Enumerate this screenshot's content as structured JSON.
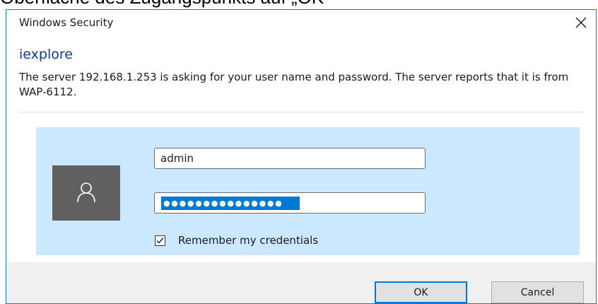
{
  "background_caption": "Oberfläche des Zugangspunkts auf „OK“",
  "window": {
    "title": "Windows Security",
    "close_icon": "close-icon"
  },
  "prompt": {
    "app_name": "iexplore",
    "message": "The server 192.168.1.253 is asking for your user name and password. The server reports that it is from WAP-6112."
  },
  "credentials": {
    "avatar_icon": "user-icon",
    "username_value": "admin",
    "password_masked": "●●●●●●●●●●●●●●●",
    "password_selected": true,
    "remember_label": "Remember my credentials",
    "remember_checked": true
  },
  "buttons": {
    "ok_label": "OK",
    "cancel_label": "Cancel"
  },
  "colors": {
    "accent": "#0078d7",
    "panel_bg": "#cce8ff",
    "app_name": "#0b3c9e",
    "avatar_bg": "#616161",
    "footer_bg": "#f0f0f0",
    "window_border": "#1e74c9"
  }
}
